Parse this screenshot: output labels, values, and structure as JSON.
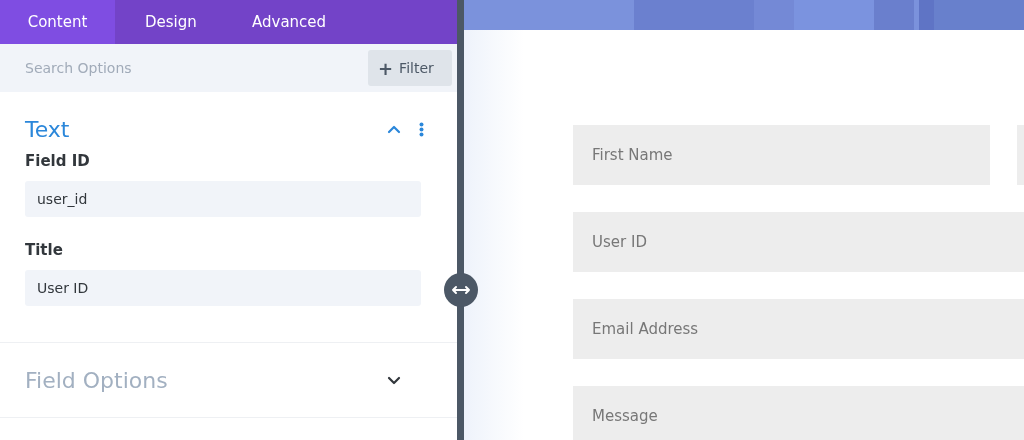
{
  "tabs": [
    {
      "label": "Content",
      "selected": true
    },
    {
      "label": "Design",
      "selected": false
    },
    {
      "label": "Advanced",
      "selected": false
    }
  ],
  "search": {
    "placeholder": "Search Options"
  },
  "filter_button": {
    "icon": "+",
    "label": "Filter"
  },
  "sections": [
    {
      "title": "Text",
      "expanded": true,
      "fields": [
        {
          "label": "Field ID",
          "value": "user_id"
        },
        {
          "label": "Title",
          "value": "User ID"
        }
      ]
    },
    {
      "title": "Field Options",
      "expanded": false
    }
  ],
  "preview": {
    "form_fields": [
      {
        "placeholder": "First Name",
        "kind": "half"
      },
      {
        "placeholder": "User ID",
        "kind": "full"
      },
      {
        "placeholder": "Email Address",
        "kind": "full"
      },
      {
        "placeholder": "Message",
        "kind": "full"
      }
    ]
  }
}
